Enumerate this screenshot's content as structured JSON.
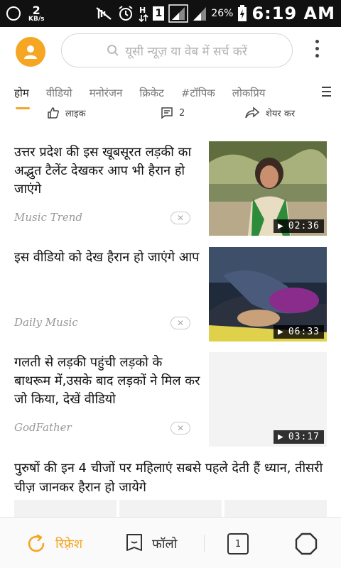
{
  "status_bar": {
    "net_speed": "2",
    "net_unit": "KB/s",
    "sim": "1",
    "battery": "26%",
    "time": "6:19 AM"
  },
  "header": {
    "search_placeholder": "यूसी न्यूज़ या वेब में सर्च करें"
  },
  "tabs": [
    {
      "label": "होम",
      "active": true
    },
    {
      "label": "वीडियो"
    },
    {
      "label": "मनोरंजन"
    },
    {
      "label": "क्रिकेट"
    },
    {
      "label": "#टॉपिक"
    },
    {
      "label": "लोकप्रिय"
    }
  ],
  "actions": {
    "like": "लाइक",
    "comments": "2",
    "share": "शेयर कर"
  },
  "feed": [
    {
      "title": "उत्तर प्रदेश की इस खूबसूरत लड़की का अद्भुत टैलेंट देखकर आप भी हैरान हो जाएंगे",
      "source": "Music Trend",
      "duration": "02:36"
    },
    {
      "title": "इस वीडियो को देख हैरान हो जाएंगे आप",
      "source": "Daily Music",
      "duration": "06:33"
    },
    {
      "title": "गलती से लड़की पहुंची लड़को के बाथरूम में,उसके बाद लड़कों ने मिल कर जो किया, देखें वीडियो",
      "source": "GodFather",
      "duration": "03:17"
    },
    {
      "title": "पुरुषों की इन 4 चीजों पर महिलाएं सबसे पहले देती हैं ध्यान, तीसरी चीज़ जानकर हैरान हो जायेगे"
    }
  ],
  "bottom_bar": {
    "refresh": "रिफ़्रेश",
    "follow": "फॉलो",
    "window_count": "1"
  },
  "colors": {
    "accent": "#f5a623",
    "status_bar": "#111111"
  }
}
